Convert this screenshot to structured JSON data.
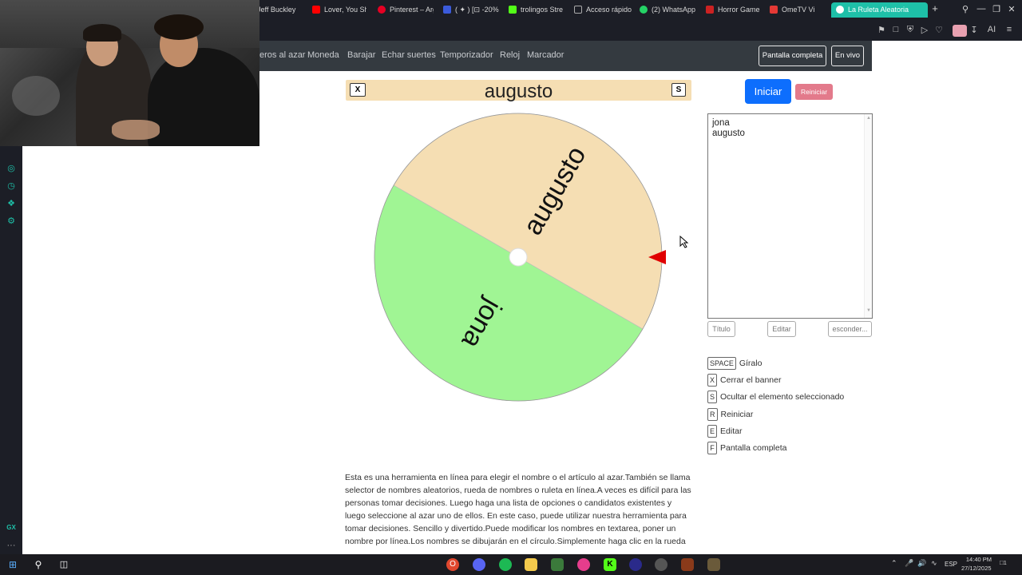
{
  "browser": {
    "tabs": [
      {
        "label": "Jeff Buckley",
        "color": "#e8a23c"
      },
      {
        "label": "Lover, You Sh",
        "color": "#ff0000"
      },
      {
        "label": "Pinterest – Arg",
        "color": "#e60023"
      },
      {
        "label": "( ✦ ) [⊡ -20%",
        "color": "#3b5bdb"
      },
      {
        "label": "trolingos Stre",
        "color": "#53fc18"
      },
      {
        "label": "Acceso rápido",
        "color": "#888888"
      },
      {
        "label": "(2) WhatsApp",
        "color": "#25d366"
      },
      {
        "label": "Horror Game",
        "color": "#cc2222"
      },
      {
        "label": "OmeTV Vi",
        "color": "#e53935"
      },
      {
        "label": "La Ruleta Aleatoria",
        "color": "#ffffff"
      }
    ],
    "new_tab": "+",
    "ai_label": "AI"
  },
  "site_nav": {
    "links": [
      "eros al azar",
      "Moneda",
      "Barajar",
      "Echar suertes",
      "Temporizador",
      "Reloj",
      "Marcador"
    ],
    "fullscreen_label": "Pantalla completa",
    "live_label": "En vivo"
  },
  "banner": {
    "close_key": "X",
    "hide_key": "S",
    "winner": "augusto"
  },
  "wheel": {
    "segments": [
      {
        "name": "augusto",
        "color": "#f5deb3"
      },
      {
        "name": "jona",
        "color": "#a0f594"
      }
    ],
    "pointer_color": "#e00000"
  },
  "controls": {
    "start_label": "Iniciar",
    "reset_label": "Reiniciar"
  },
  "names_text": "jona\naugusto",
  "editor_buttons": {
    "title": "Título",
    "edit": "Editar",
    "hide": "esconder..."
  },
  "shortcuts": [
    {
      "key": "SPACE",
      "label": "Gíralo"
    },
    {
      "key": "X",
      "label": "Cerrar el banner"
    },
    {
      "key": "S",
      "label": "Ocultar el elemento seleccionado"
    },
    {
      "key": "R",
      "label": "Reiniciar"
    },
    {
      "key": "E",
      "label": "Editar"
    },
    {
      "key": "F",
      "label": "Pantalla completa"
    }
  ],
  "description": "Esta es una herramienta en línea para elegir el nombre o el artículo al azar.También se llama selector de nombres aleatorios, rueda de nombres o ruleta en línea.A veces es difícil para las personas tomar decisiones. Luego haga una lista de opciones o candidatos existentes y luego seleccione al azar uno de ellos. En este caso, puede utilizar nuestra herramienta para tomar decisiones. Sencillo y divertido.Puede modificar los nombres en textarea, poner un nombre por línea.Los nombres se dibujarán en el círculo.Simplemente haga clic en la rueda",
  "sidebar": {
    "gx_label": "GX",
    "more_label": "···"
  },
  "taskbar": {
    "lang": "ESP",
    "time": "14:40 PM",
    "date": "27/12/2025",
    "notif_count": "1"
  }
}
